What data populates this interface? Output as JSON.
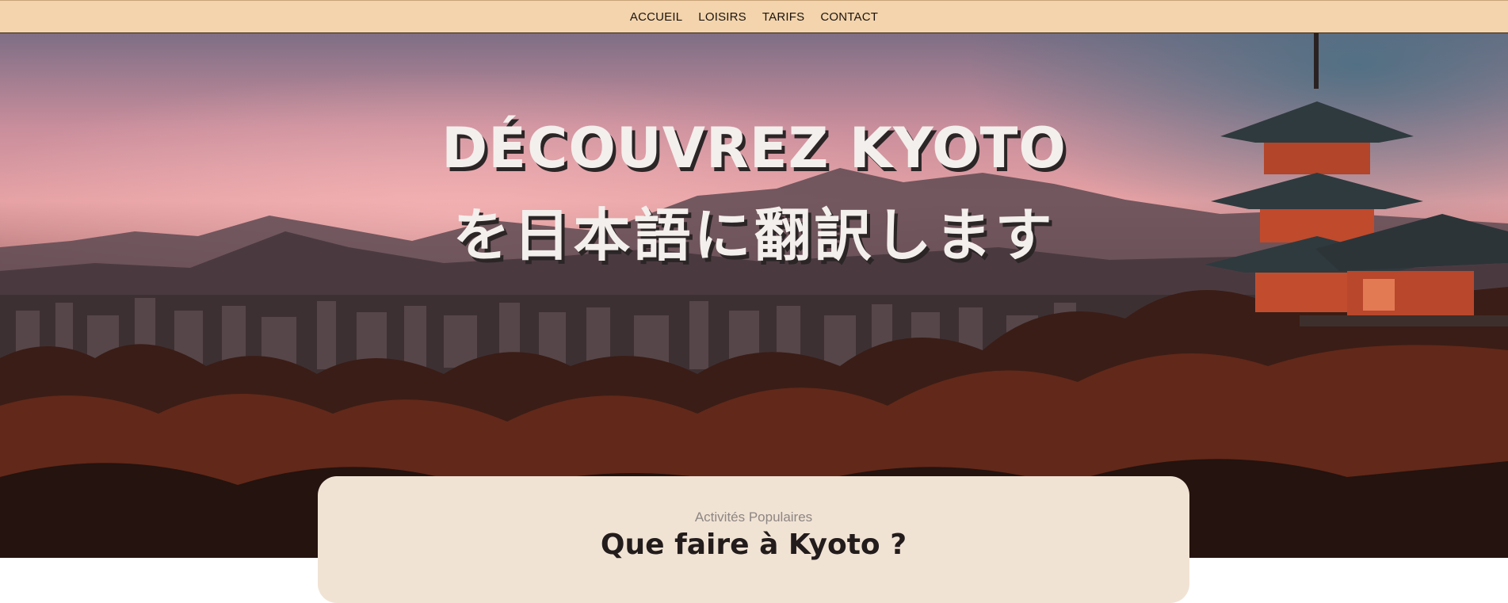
{
  "nav": {
    "items": [
      {
        "label": "ACCUEIL"
      },
      {
        "label": "LOISIRS"
      },
      {
        "label": "TARIFS"
      },
      {
        "label": "CONTACT"
      }
    ]
  },
  "hero": {
    "title_line1": "DÉCOUVREZ KYOTO",
    "title_line2": "を日本語に翻訳します"
  },
  "section": {
    "eyebrow": "Activités Populaires",
    "title": "Que faire à Kyoto ?"
  },
  "colors": {
    "nav_background": "#f3d4ac",
    "card_background": "#f1e3d4",
    "hero_text": "#f3efec",
    "hero_text_shadow": "#2b2526"
  }
}
